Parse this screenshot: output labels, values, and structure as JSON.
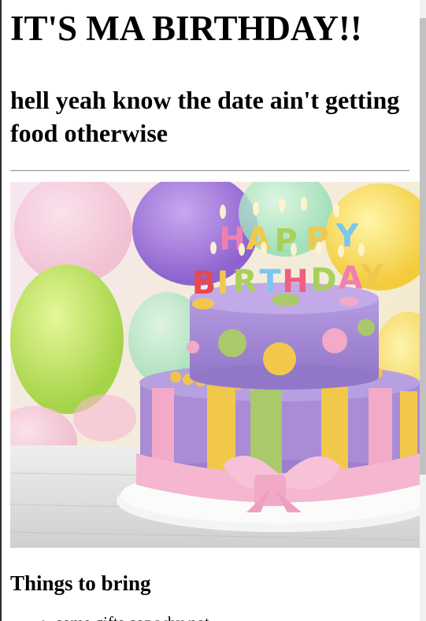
{
  "page": {
    "title": "IT'S MA BIRTHDAY!!",
    "subtitle": "hell yeah know the date ain't getting food otherwise",
    "image": {
      "icon": "birthday-cake-image",
      "cake_text": "HAPPY BIRTHDAY",
      "cake_text_top": "HAPPY",
      "cake_text_bottom": "BIRTHDAY"
    },
    "section_heading": "Things to bring",
    "list_items": [
      "some gifts coz why not"
    ]
  },
  "colors": {
    "text": "#000000",
    "background": "#ffffff",
    "divider": "#9c9c9c",
    "cake_purple": "#a98bd6",
    "cake_pink": "#f3a9c8",
    "cake_yellow": "#f2c84b",
    "cake_green": "#a9c96a"
  }
}
